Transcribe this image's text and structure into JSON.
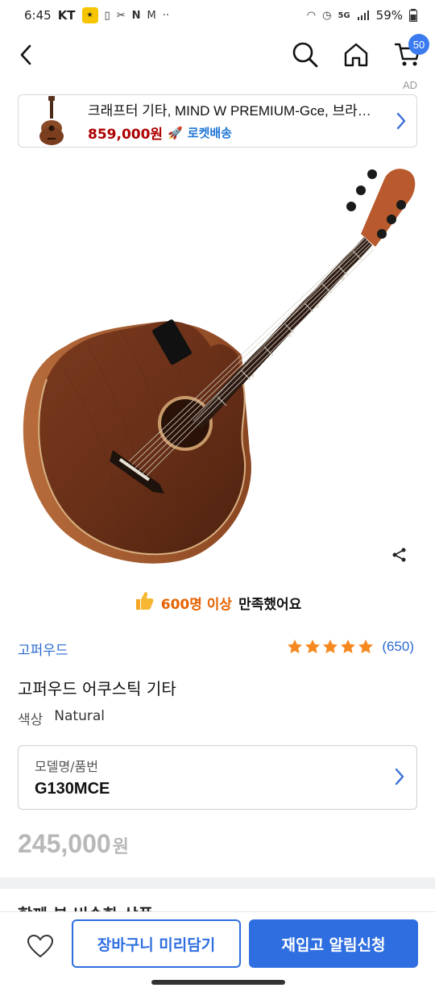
{
  "status_bar": {
    "time": "6:45",
    "carrier": "KT",
    "network": "5G",
    "battery": "59%"
  },
  "header": {
    "back_icon": "back-arrow-icon",
    "search_icon": "search-icon",
    "home_icon": "home-icon",
    "cart_icon": "cart-icon",
    "cart_count": "50"
  },
  "ad": {
    "label": "AD",
    "title": "크래프터 기타, MIND W PREMIUM-Gce, 브라…",
    "price": "859,000원",
    "delivery": "로켓배송"
  },
  "product": {
    "satisfaction_highlight": "600명 이상",
    "satisfaction_rest": "만족했어요",
    "brand": "고퍼우드",
    "rating_stars": 5,
    "review_count": "(650)",
    "title": "고퍼우드 어쿠스틱 기타",
    "color_label": "색상",
    "color_value": "Natural",
    "option_label": "모델명/품번",
    "option_value": "G130MCE",
    "price": "245,000",
    "price_unit": "원",
    "next_section_peek": "함께 본 비슷한 상품"
  },
  "bottom_bar": {
    "wishlist_icon": "heart-icon",
    "cart_button": "장바구니 미리담기",
    "notify_button": "재입고 알림신청"
  },
  "colors": {
    "accent_blue": "#2f6ee0",
    "price_red": "#ae0000",
    "star_orange": "#f5891f",
    "satisfaction_orange": "#e56200",
    "cart_badge": "#3a7bf0"
  }
}
